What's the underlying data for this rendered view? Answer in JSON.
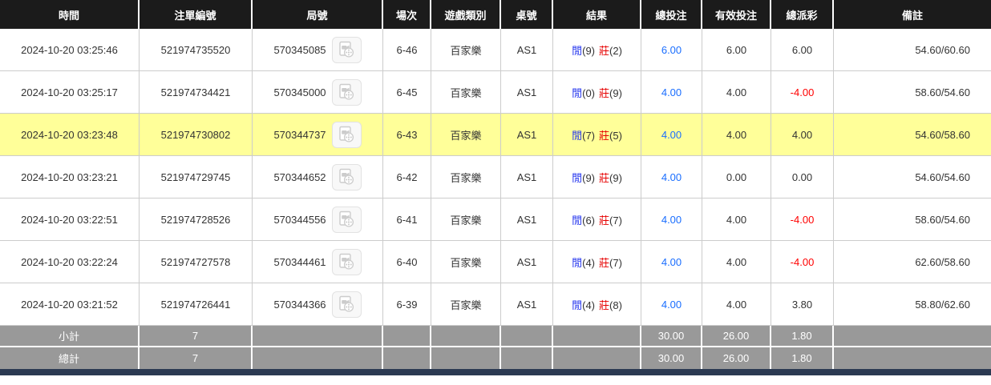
{
  "table": {
    "columns": [
      {
        "key": "time",
        "label": "時間"
      },
      {
        "key": "bet_id",
        "label": "注單編號"
      },
      {
        "key": "round_id",
        "label": "局號"
      },
      {
        "key": "session",
        "label": "場次"
      },
      {
        "key": "game_type",
        "label": "遊戲類別"
      },
      {
        "key": "table_no",
        "label": "桌號"
      },
      {
        "key": "result",
        "label": "結果"
      },
      {
        "key": "total_bet",
        "label": "總投注"
      },
      {
        "key": "valid_bet",
        "label": "有效投注"
      },
      {
        "key": "total_payout",
        "label": "總派彩"
      },
      {
        "key": "remark",
        "label": "備註"
      }
    ],
    "rows": [
      {
        "time": "2024-10-20 03:25:46",
        "bet_id": "521974735520",
        "round_id": "570345085",
        "session": "6-46",
        "game_type": "百家樂",
        "table_no": "AS1",
        "result": {
          "player_label": "閒",
          "player_num": "(9)",
          "banker_label": "莊",
          "banker_num": "(2)"
        },
        "total_bet": "6.00",
        "valid_bet": "6.00",
        "total_payout": "6.00",
        "remark": "54.60/60.60",
        "highlight": false
      },
      {
        "time": "2024-10-20 03:25:17",
        "bet_id": "521974734421",
        "round_id": "570345000",
        "session": "6-45",
        "game_type": "百家樂",
        "table_no": "AS1",
        "result": {
          "player_label": "閒",
          "player_num": "(0)",
          "banker_label": "莊",
          "banker_num": "(9)"
        },
        "total_bet": "4.00",
        "valid_bet": "4.00",
        "total_payout": "-4.00",
        "remark": "58.60/54.60",
        "highlight": false
      },
      {
        "time": "2024-10-20 03:23:48",
        "bet_id": "521974730802",
        "round_id": "570344737",
        "session": "6-43",
        "game_type": "百家樂",
        "table_no": "AS1",
        "result": {
          "player_label": "閒",
          "player_num": "(7)",
          "banker_label": "莊",
          "banker_num": "(5)"
        },
        "total_bet": "4.00",
        "valid_bet": "4.00",
        "total_payout": "4.00",
        "remark": "54.60/58.60",
        "highlight": true
      },
      {
        "time": "2024-10-20 03:23:21",
        "bet_id": "521974729745",
        "round_id": "570344652",
        "session": "6-42",
        "game_type": "百家樂",
        "table_no": "AS1",
        "result": {
          "player_label": "閒",
          "player_num": "(9)",
          "banker_label": "莊",
          "banker_num": "(9)"
        },
        "total_bet": "4.00",
        "valid_bet": "0.00",
        "total_payout": "0.00",
        "remark": "54.60/54.60",
        "highlight": false
      },
      {
        "time": "2024-10-20 03:22:51",
        "bet_id": "521974728526",
        "round_id": "570344556",
        "session": "6-41",
        "game_type": "百家樂",
        "table_no": "AS1",
        "result": {
          "player_label": "閒",
          "player_num": "(6)",
          "banker_label": "莊",
          "banker_num": "(7)"
        },
        "total_bet": "4.00",
        "valid_bet": "4.00",
        "total_payout": "-4.00",
        "remark": "58.60/54.60",
        "highlight": false
      },
      {
        "time": "2024-10-20 03:22:24",
        "bet_id": "521974727578",
        "round_id": "570344461",
        "session": "6-40",
        "game_type": "百家樂",
        "table_no": "AS1",
        "result": {
          "player_label": "閒",
          "player_num": "(4)",
          "banker_label": "莊",
          "banker_num": "(7)"
        },
        "total_bet": "4.00",
        "valid_bet": "4.00",
        "total_payout": "-4.00",
        "remark": "62.60/58.60",
        "highlight": false
      },
      {
        "time": "2024-10-20 03:21:52",
        "bet_id": "521974726441",
        "round_id": "570344366",
        "session": "6-39",
        "game_type": "百家樂",
        "table_no": "AS1",
        "result": {
          "player_label": "閒",
          "player_num": "(4)",
          "banker_label": "莊",
          "banker_num": "(8)"
        },
        "total_bet": "4.00",
        "valid_bet": "4.00",
        "total_payout": "3.80",
        "remark": "58.80/62.60",
        "highlight": false
      }
    ],
    "footer": [
      {
        "label": "小計",
        "count": "7",
        "total_bet": "30.00",
        "valid_bet": "26.00",
        "total_payout": "1.80"
      },
      {
        "label": "總計",
        "count": "7",
        "total_bet": "30.00",
        "valid_bet": "26.00",
        "total_payout": "1.80"
      }
    ]
  },
  "icons": {
    "video_replay": "video-file-icon"
  },
  "colors": {
    "header_bg": "#1b1b1b",
    "highlight_row": "#ffff99",
    "footer_bg": "#999999",
    "bottom_bar": "#2b3a52",
    "bet_amount_blue": "#1a6eff",
    "player_blue": "#2233ee",
    "banker_red": "#e60000",
    "negative_red": "#ff0000"
  }
}
